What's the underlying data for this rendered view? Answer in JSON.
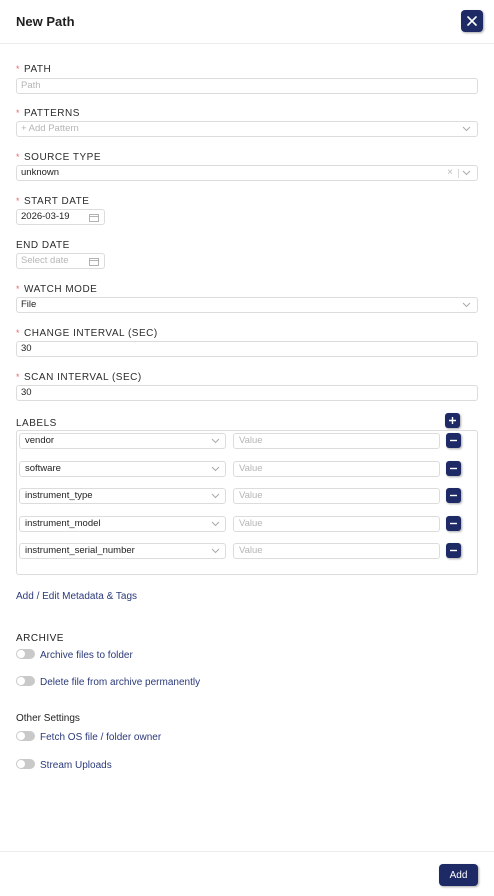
{
  "header": {
    "title": "New Path",
    "close_icon": "close-icon"
  },
  "form": {
    "path": {
      "label": "PATH",
      "placeholder": "Path"
    },
    "patterns": {
      "label": "PATTERNS",
      "placeholder": "+ Add Pattern"
    },
    "source_type": {
      "label": "SOURCE TYPE",
      "value": "unknown",
      "clear": "×"
    },
    "start_date": {
      "label": "START DATE",
      "value": "2026-03-19"
    },
    "end_date": {
      "label": "END DATE",
      "placeholder": "Select date"
    },
    "watch_mode": {
      "label": "WATCH MODE",
      "value": "File"
    },
    "change_interval": {
      "label": "CHANGE INTERVAL (SEC)",
      "value": "30"
    },
    "scan_interval": {
      "label": "SCAN INTERVAL (SEC)",
      "value": "30"
    },
    "required_mark": "*"
  },
  "labels": {
    "title": "LABELS",
    "value_placeholder": "Value",
    "rows": [
      {
        "key": "vendor"
      },
      {
        "key": "software"
      },
      {
        "key": "instrument_type"
      },
      {
        "key": "instrument_model"
      },
      {
        "key": "instrument_serial_number"
      }
    ]
  },
  "metadata_link": "Add / Edit Metadata & Tags",
  "archive": {
    "title": "ARCHIVE",
    "toggles": [
      {
        "label": "Archive files to folder",
        "on": false
      },
      {
        "label": "Delete file from archive permanently",
        "on": false
      }
    ]
  },
  "other_settings": {
    "title": "Other Settings",
    "toggles": [
      {
        "label": "Fetch OS file / folder owner",
        "on": false
      },
      {
        "label": "Stream Uploads",
        "on": false
      }
    ]
  },
  "footer": {
    "add_label": "Add"
  },
  "colors": {
    "primary": "#1d2a66",
    "required": "#e36a6a",
    "link": "#2b3a7a"
  }
}
